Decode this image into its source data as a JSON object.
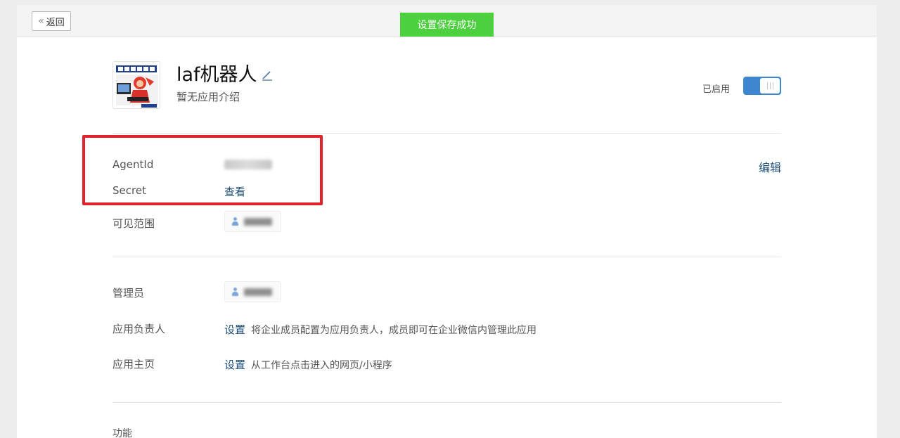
{
  "topbar": {
    "back_label": "返回"
  },
  "toast": {
    "message": "设置保存成功",
    "color": "#4cd03f"
  },
  "app": {
    "name": "laf机器人",
    "description": "暂无应用介绍",
    "status_label": "已启用",
    "enabled": true,
    "accent_color": "#3f86d1"
  },
  "credentials": {
    "agentid_label": "AgentId",
    "secret_label": "Secret",
    "secret_view_link": "查看",
    "edit_link": "编辑"
  },
  "visibility": {
    "label": "可见范围"
  },
  "admins": {
    "label": "管理员"
  },
  "owner": {
    "label": "应用负责人",
    "link": "设置",
    "hint": "将企业成员配置为应用负责人，成员即可在企业微信内管理此应用"
  },
  "homepage": {
    "label": "应用主页",
    "link": "设置",
    "hint": "从工作台点击进入的网页/小程序"
  },
  "features": {
    "section_title": "功能"
  },
  "icons": {
    "back": "double-chevron-left-icon",
    "edit": "pencil-icon",
    "member": "user-icon"
  },
  "highlight_color": "#e0242e"
}
